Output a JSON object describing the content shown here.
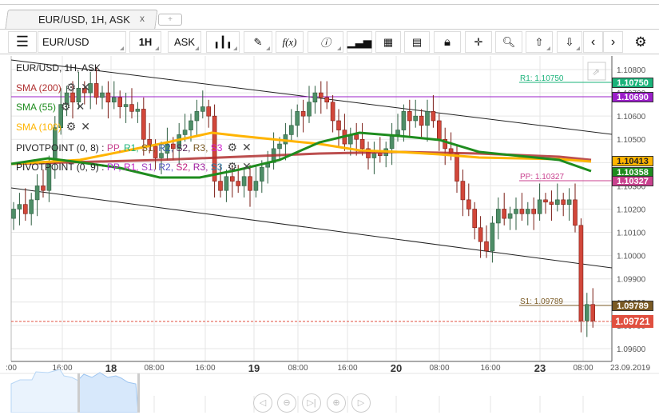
{
  "tab": {
    "label": "EUR/USD, 1H, ASK",
    "close": "x",
    "add": "+"
  },
  "toolbar": {
    "symbol": "EUR/USD",
    "period": "1H",
    "side": "ASK",
    "fx": "f(x)"
  },
  "legend": {
    "title": "EUR/USD, 1H, ASK",
    "sma200": "SMA (200)",
    "sma55": "SMA (55)",
    "sma100": "SMA (100)",
    "pivot1": "PIVOTPOINT (0, 8)",
    "pivot2": "PIVOTPOINT (0, 9)",
    "pivot_items": [
      "PP,",
      "R1,",
      "S1,",
      "R2,",
      "S2,",
      "R3,",
      "S3"
    ]
  },
  "levels": {
    "r1": "R1: 1.10750",
    "pp": "PP: 1.10327",
    "s1": "S1: 1.09789"
  },
  "price_labels": {
    "r1": "1.10750",
    "purple": "1.10690",
    "sma100": "1.10413",
    "sma55": "1.10358",
    "pp": "1.10327",
    "s1": "1.09789",
    "last": "1.09721"
  },
  "colors": {
    "up": "#4e8e67",
    "down": "#d2473a",
    "sma200": "#b03030",
    "sma55": "#1e8c1e",
    "sma100": "#ffb400",
    "r1": "#1bb37a",
    "purple": "#9b1fc9",
    "pp": "#c9428f",
    "s1": "#7a5a24",
    "last": "#e05040"
  },
  "chart_data": {
    "type": "candlestick",
    "title": "EUR/USD, 1H, ASK",
    "ylim": [
      1.0955,
      1.1086
    ],
    "y_ticks": [
      "1.10800",
      "1.10700",
      "1.10600",
      "1.10500",
      "1.10400",
      "1.10300",
      "1.10200",
      "1.10100",
      "1.10000",
      "1.09900",
      "1.09800",
      "1.09700",
      "1.09600"
    ],
    "x_ticks": [
      ":00",
      "16:00",
      "18",
      "08:00",
      "16:00",
      "19",
      "08:00",
      "16:00",
      "20",
      "08:00",
      "16:00",
      "23",
      "08:00",
      "23.09.2019"
    ],
    "open_first": 1.1016,
    "closes": [
      1.102,
      1.1022,
      1.1018,
      1.1024,
      1.103,
      1.1028,
      1.104,
      1.1055,
      1.1065,
      1.107,
      1.1066,
      1.1072,
      1.107,
      1.1074,
      1.1068,
      1.107,
      1.1066,
      1.1068,
      1.1064,
      1.1065,
      1.1062,
      1.1063,
      1.105,
      1.1047,
      1.1042,
      1.1044,
      1.1048,
      1.1046,
      1.1052,
      1.1054,
      1.1058,
      1.1062,
      1.1064,
      1.106,
      1.1032,
      1.1028,
      1.1034,
      1.1032,
      1.103,
      1.1034,
      1.1028,
      1.1032,
      1.1038,
      1.104,
      1.1046,
      1.1048,
      1.1052,
      1.1056,
      1.1062,
      1.106,
      1.1066,
      1.107,
      1.1068,
      1.1066,
      1.1058,
      1.1054,
      1.1048,
      1.1052,
      1.105,
      1.1046,
      1.1042,
      1.1044,
      1.1043,
      1.1046,
      1.1052,
      1.1054,
      1.1062,
      1.1058,
      1.106,
      1.1056,
      1.1062,
      1.1058,
      1.105,
      1.1046,
      1.1044,
      1.1032,
      1.1024,
      1.102,
      1.1012,
      1.1006,
      1.1002,
      1.1014,
      1.102,
      1.1016,
      1.1018,
      1.102,
      1.1018,
      1.102,
      1.1018,
      1.1024,
      1.1023,
      1.1022,
      1.1024,
      1.1022,
      1.1024,
      1.1013,
      1.0972,
      1.0979,
      1.0972
    ]
  }
}
